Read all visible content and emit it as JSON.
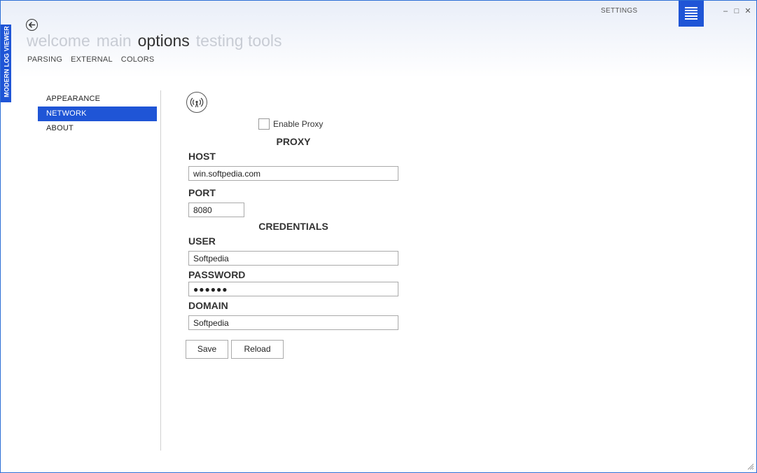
{
  "app": {
    "side_title": "MODERN LOG VIEWER",
    "settings_label": "SETTINGS",
    "brand_color": "#1f55d6"
  },
  "window_controls": {
    "minimize": "–",
    "maximize": "□",
    "close": "✕"
  },
  "pivot": {
    "items": [
      "welcome",
      "main",
      "options",
      "testing tools"
    ],
    "active": "options"
  },
  "subtabs": [
    "PARSING",
    "EXTERNAL",
    "COLORS"
  ],
  "nav": {
    "items": [
      "APPEARANCE",
      "NETWORK",
      "ABOUT"
    ],
    "selected": "NETWORK"
  },
  "form": {
    "enable_proxy_label": "Enable Proxy",
    "enable_proxy_checked": false,
    "proxy_section": "PROXY",
    "host_label": "HOST",
    "host_value": "win.softpedia.com",
    "port_label": "PORT",
    "port_value": "8080",
    "credentials_section": "CREDENTIALS",
    "user_label": "USER",
    "user_value": "Softpedia",
    "password_label": "PASSWORD",
    "password_value": "●●●●●●",
    "domain_label": "DOMAIN",
    "domain_value": "Softpedia",
    "save_label": "Save",
    "reload_label": "Reload"
  }
}
